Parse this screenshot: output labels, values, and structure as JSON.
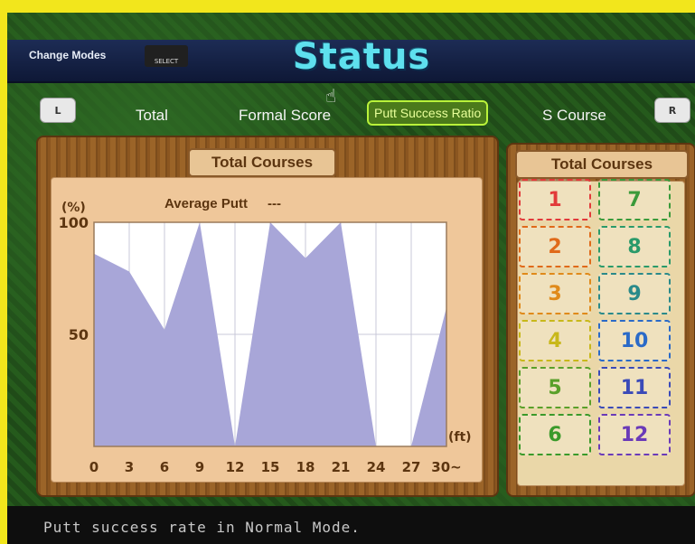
{
  "header": {
    "change_modes_label": "Change Modes",
    "select_label": "SELECT",
    "title": "Status"
  },
  "tabs": {
    "left_button": "L",
    "right_button": "R",
    "items": [
      {
        "label": "Total"
      },
      {
        "label": "Formal Score"
      },
      {
        "label": "Putt Success Ratio",
        "selected": true
      },
      {
        "label": "S Course"
      }
    ]
  },
  "graph_panel": {
    "title": "Total Courses"
  },
  "course_panel": {
    "title": "Total Courses",
    "courses": [
      {
        "num": "1",
        "color": "#e23a3a"
      },
      {
        "num": "7",
        "color": "#3a9a3a"
      },
      {
        "num": "2",
        "color": "#e06a1a"
      },
      {
        "num": "8",
        "color": "#2a9a6a"
      },
      {
        "num": "3",
        "color": "#e08a1a"
      },
      {
        "num": "9",
        "color": "#2a8a8a"
      },
      {
        "num": "4",
        "color": "#c8b81a"
      },
      {
        "num": "10",
        "color": "#2a6ac8"
      },
      {
        "num": "5",
        "color": "#5aa02a"
      },
      {
        "num": "11",
        "color": "#3a4ab8"
      },
      {
        "num": "6",
        "color": "#3a9a2a"
      },
      {
        "num": "12",
        "color": "#6a3ab8"
      }
    ]
  },
  "chart_data": {
    "type": "area",
    "title": "Average Putt",
    "title_value": "---",
    "ylabel": "(%)",
    "xlabel": "(ft)",
    "x": [
      0,
      3,
      6,
      9,
      12,
      15,
      18,
      21,
      24,
      27,
      30
    ],
    "x_tick_labels": [
      "0",
      "3",
      "6",
      "9",
      "12",
      "15",
      "18",
      "21",
      "24",
      "27",
      "30~"
    ],
    "y_ticks": [
      100,
      50
    ],
    "ylim": [
      0,
      100
    ],
    "values": [
      86,
      78,
      52,
      100,
      0,
      100,
      84,
      100,
      0,
      0,
      62
    ],
    "fill_color": "#a8a6d8",
    "grid": true
  },
  "footer": {
    "message": "Putt success rate in Normal Mode."
  }
}
